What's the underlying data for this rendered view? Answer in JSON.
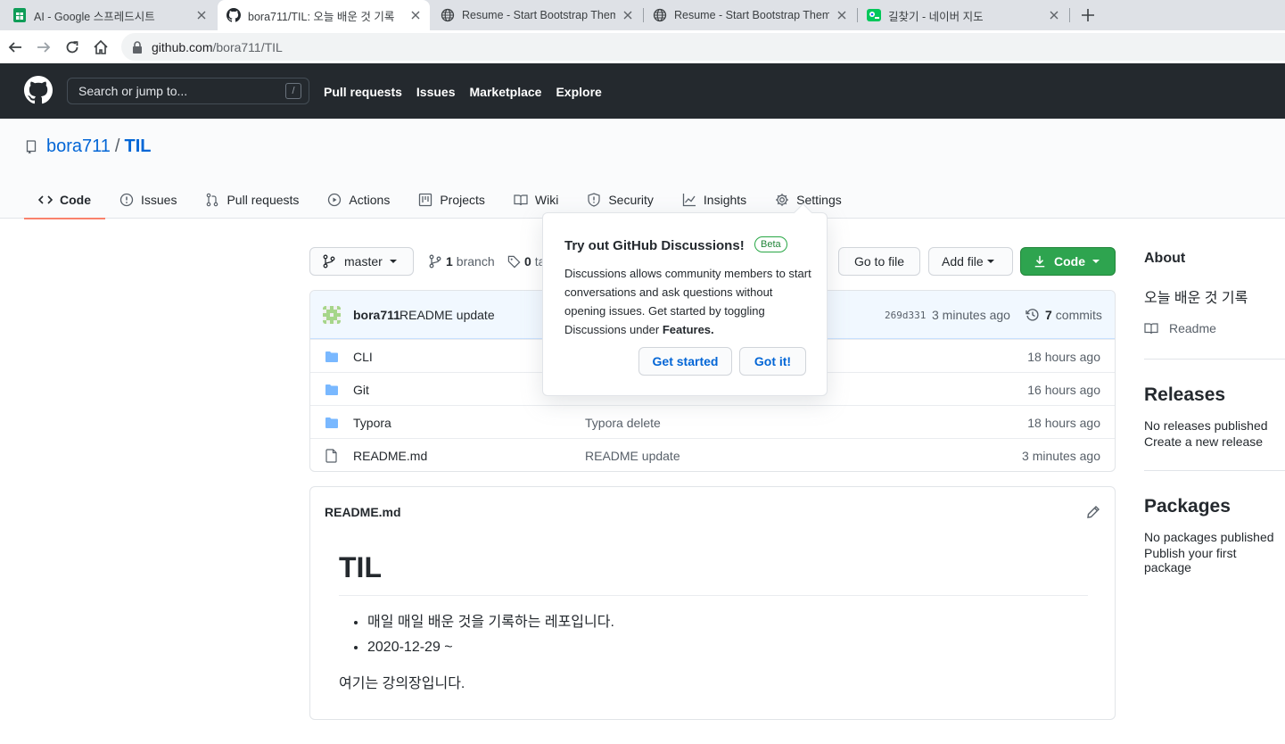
{
  "browser": {
    "tabs": [
      {
        "title": "AI - Google 스프레드시트",
        "icon": "sheets-icon"
      },
      {
        "title": "bora711/TIL: 오늘 배운 것 기록",
        "icon": "github-icon"
      },
      {
        "title": "Resume - Start Bootstrap Theme",
        "icon": "globe-icon"
      },
      {
        "title": "Resume - Start Bootstrap Theme",
        "icon": "globe-icon"
      },
      {
        "title": "길찾기 - 네이버 지도",
        "icon": "naver-map-icon"
      }
    ],
    "url_host": "github.com",
    "url_path": "/bora711/TIL"
  },
  "header": {
    "search_placeholder": "Search or jump to...",
    "search_key": "/",
    "nav": [
      "Pull requests",
      "Issues",
      "Marketplace",
      "Explore"
    ]
  },
  "repo": {
    "owner": "bora711",
    "separator": "/",
    "name": "TIL",
    "tabs": [
      "Code",
      "Issues",
      "Pull requests",
      "Actions",
      "Projects",
      "Wiki",
      "Security",
      "Insights",
      "Settings"
    ]
  },
  "toolbar": {
    "branch": "master",
    "branch_count": "1",
    "branch_label": "branch",
    "tag_count": "0",
    "tag_label": "ta",
    "go_to_file": "Go to file",
    "add_file": "Add file",
    "code": "Code"
  },
  "commit": {
    "author": "bora711",
    "message": "README update",
    "sha": "269d331",
    "time": "3 minutes ago",
    "count": "7",
    "count_label": "commits"
  },
  "files": [
    {
      "name": "CLI",
      "type": "folder",
      "message": "",
      "time": "18 hours ago"
    },
    {
      "name": "Git",
      "type": "folder",
      "message": "",
      "time": "16 hours ago"
    },
    {
      "name": "Typora",
      "type": "folder",
      "message": "Typora delete",
      "time": "18 hours ago"
    },
    {
      "name": "README.md",
      "type": "file",
      "message": "README update",
      "time": "3 minutes ago"
    }
  ],
  "readme": {
    "filename": "README.md",
    "heading": "TIL",
    "items": [
      "매일 매일 배운 것을 기록하는 레포입니다.",
      "2020-12-29 ~"
    ],
    "paragraph": "여기는 강의장입니다."
  },
  "sidebar": {
    "about_title": "About",
    "description": "오늘 배운 것 기록",
    "readme_label": "Readme",
    "releases_title": "Releases",
    "releases_none": "No releases published",
    "releases_link": "Create a new release",
    "packages_title": "Packages",
    "packages_none": "No packages published",
    "packages_link": "Publish your first package"
  },
  "popover": {
    "title": "Try out GitHub Discussions!",
    "badge": "Beta",
    "body_text": "Discussions allows community members to start conversations and ask questions without opening issues. Get started by toggling Discussions under",
    "body_bold": "Features.",
    "get_started": "Get started",
    "got_it": "Got it!"
  },
  "colors": {
    "header_bg": "#24292e",
    "link": "#0366d6",
    "green_button": "#2ea44f",
    "tab_underline": "#f9826c",
    "folder": "#79b8ff"
  }
}
